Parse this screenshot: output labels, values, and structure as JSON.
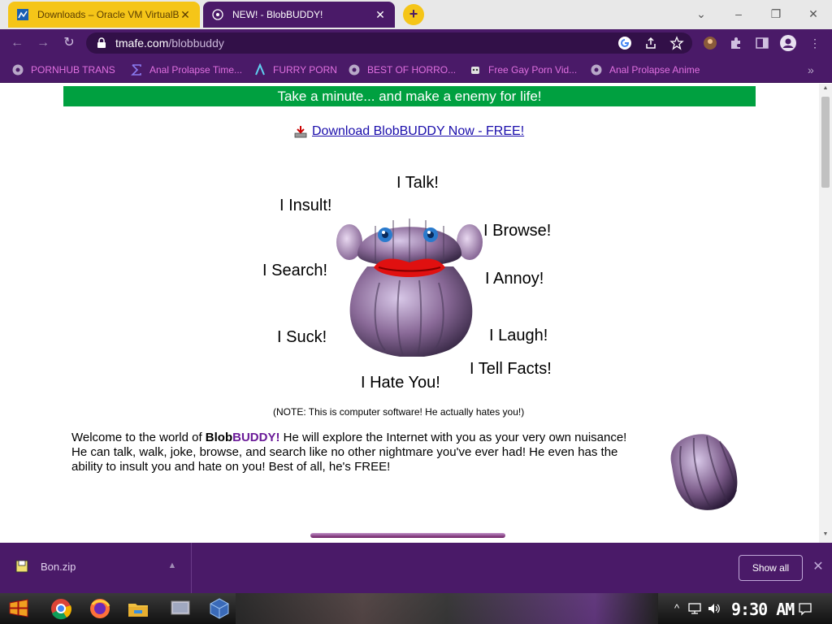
{
  "tabs": [
    {
      "title": "Downloads – Oracle VM VirtualBox",
      "close": "✕"
    },
    {
      "title": "NEW! - BlobBUDDY!",
      "close": "✕"
    }
  ],
  "new_tab": "+",
  "window_controls": {
    "dropdown": "⌄",
    "minimize": "–",
    "restore": "❐",
    "close": "✕"
  },
  "toolbar": {
    "back": "←",
    "forward": "→",
    "reload": "↻",
    "url_domain": "tmafe.com",
    "url_path": "/blobbuddy",
    "menu": "⋮"
  },
  "bookmarks": [
    {
      "label": "PORNHUB TRANS"
    },
    {
      "label": "Anal Prolapse Time..."
    },
    {
      "label": "FURRY PORN"
    },
    {
      "label": "BEST OF HORRO..."
    },
    {
      "label": "Free Gay Porn Vid..."
    },
    {
      "label": "Anal Prolapse Anime"
    }
  ],
  "bookmarks_overflow": "»",
  "page": {
    "banner": "Take a minute... and make a enemy for life!",
    "download_link": "Download BlobBUDDY Now - FREE!",
    "bubbles": {
      "talk": "I Talk!",
      "insult": "I Insult!",
      "browse": "I Browse!",
      "search": "I Search!",
      "annoy": "I Annoy!",
      "suck": "I Suck!",
      "laugh": "I Laugh!",
      "facts": "I Tell Facts!",
      "hate": "I Hate You!"
    },
    "note": "(NOTE: This is computer software! He actually hates you!)",
    "welcome": {
      "intro": "Welcome to the world of ",
      "blob": "Blob",
      "buddy": "BUDDY!",
      "rest": " He will explore the Internet with you as your very own nuisance!  He can talk, walk, joke, browse, and search like no other nightmare you've ever had! He even has the ability to insult you and hate on you! Best of all, he's FREE!"
    }
  },
  "download_shelf": {
    "filename": "Bon.zip",
    "show_all": "Show all",
    "close": "✕"
  },
  "taskbar": {
    "clock": "9:30 AM"
  },
  "colors": {
    "browser_theme": "#4a1a68",
    "banner_green": "#00a040",
    "tab_yellow": "#f5c518",
    "bookmark_text": "#e070e0"
  }
}
